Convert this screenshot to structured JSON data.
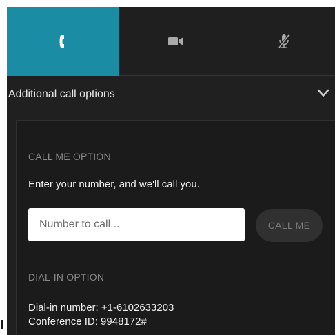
{
  "tabs": [
    {
      "icon": "phone-icon",
      "active": true
    },
    {
      "icon": "video-camera-icon",
      "active": false
    },
    {
      "icon": "microphone-muted-icon",
      "active": false
    }
  ],
  "colors": {
    "accent": "#1a8ca3",
    "panel_bg": "#202020",
    "text": "#f0f0f0",
    "muted_text": "#8a8a8a"
  },
  "options": {
    "title": "Additional call options",
    "expand_icon": "chevron-down-icon"
  },
  "call_me": {
    "section_label": "CALL ME OPTION",
    "instruction": "Enter your number, and we'll call you.",
    "input_placeholder": "Number to call...",
    "input_value": "",
    "button_label": "CALL ME"
  },
  "dial_in": {
    "section_label": "DIAL-IN OPTION",
    "number_line": "Dial-in number: +1-6102633203",
    "conference_line": "Conference ID: 9948172#"
  }
}
